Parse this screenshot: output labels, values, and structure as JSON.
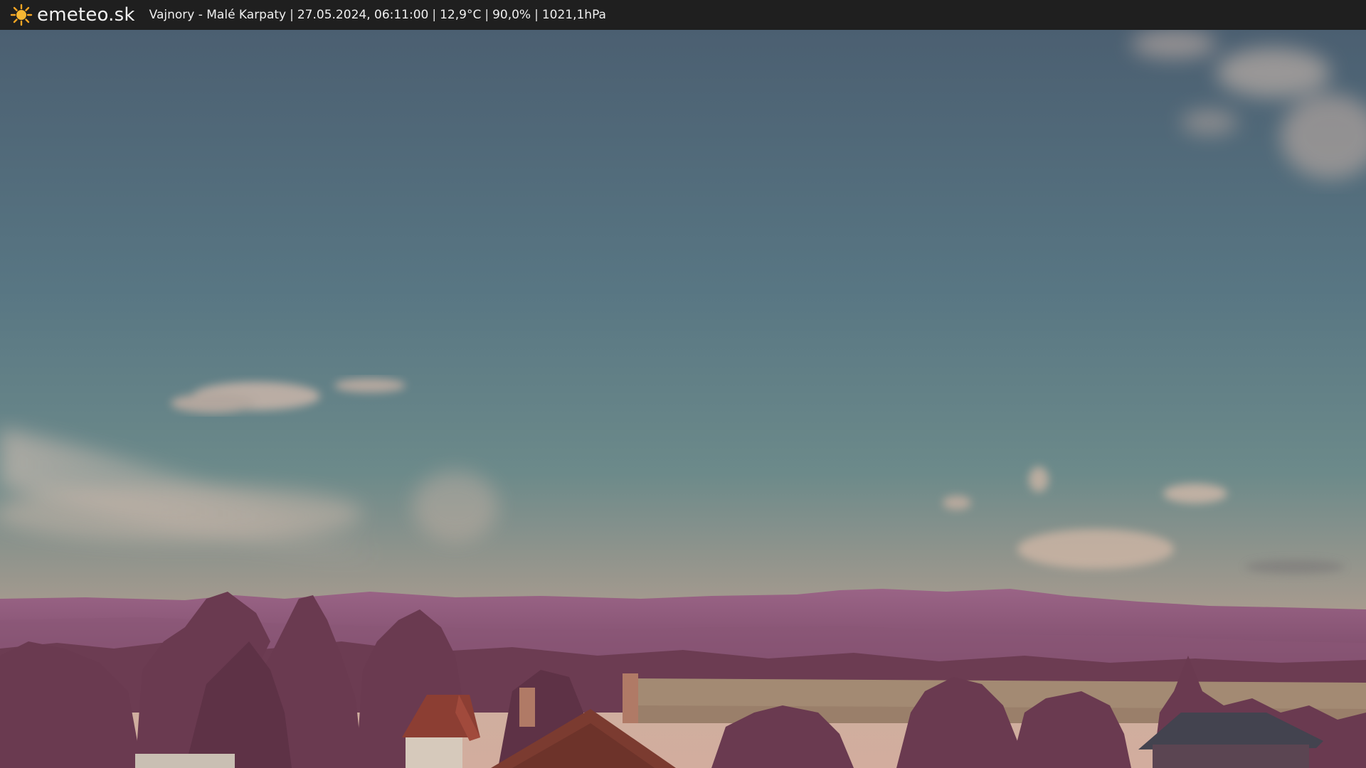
{
  "header": {
    "logo": {
      "icon": "sun-icon",
      "text": "emeteo.sk",
      "icon_color": "#f5a623"
    },
    "location": "Vajnory - Malé Karpaty",
    "datetime": "27.05.2024, 06:11:00",
    "temperature": "12,9°C",
    "humidity": "90,0%",
    "pressure": "1021,1hPa",
    "separator": "|"
  },
  "scene": {
    "description_colors": {
      "sky_top": "#4e6272",
      "sky_mid": "#5f7d86",
      "sky_horizon": "#c9a79a",
      "hills": "#8d5a7a",
      "trees": "#6e3e52",
      "field": "#a08670",
      "roof": "#7b3a30"
    }
  }
}
